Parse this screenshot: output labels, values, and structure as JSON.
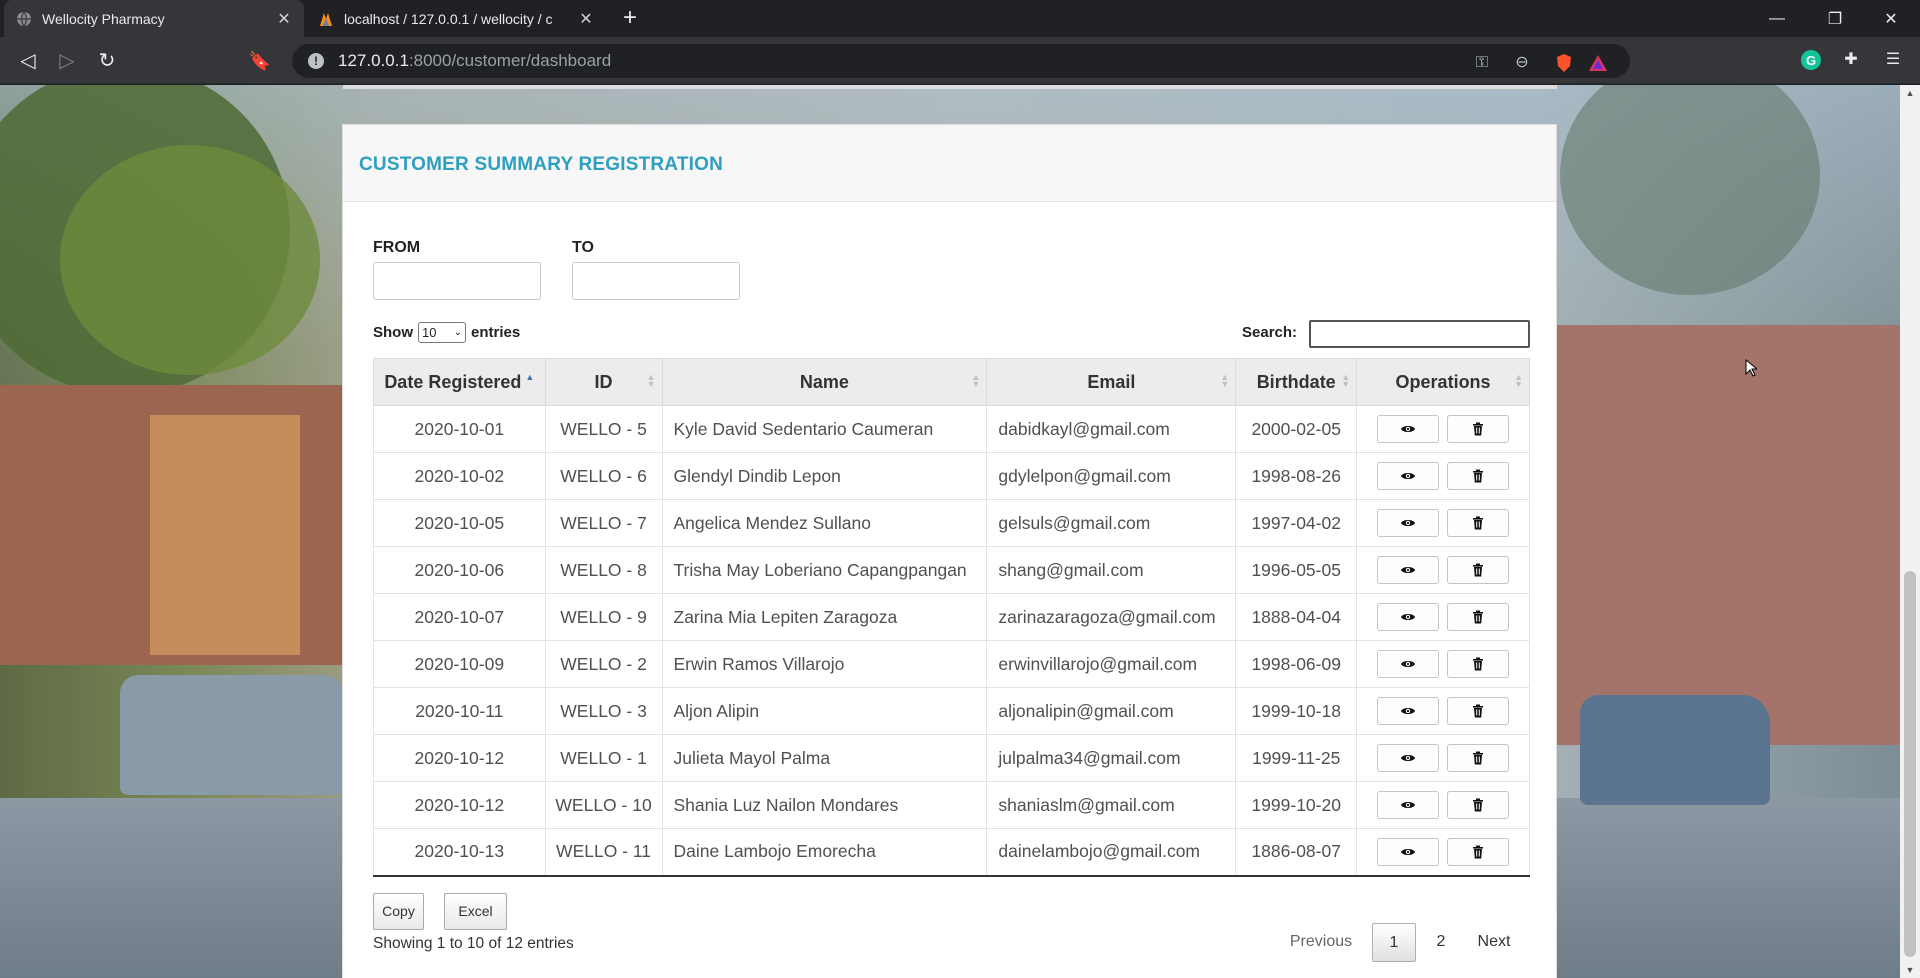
{
  "browser": {
    "tabs": [
      {
        "title": "Wellocity Pharmacy",
        "active": true
      },
      {
        "title": "localhost / 127.0.0.1 / wellocity / c",
        "active": false
      }
    ],
    "url_host": "127.0.0.1",
    "url_rest": ":8000/customer/dashboard"
  },
  "card": {
    "title": "CUSTOMER SUMMARY REGISTRATION",
    "from_label": "FROM",
    "to_label": "TO"
  },
  "controls": {
    "show_label": "Show",
    "entries_value": "10",
    "entries_label": "entries",
    "search_label": "Search:"
  },
  "table": {
    "columns": [
      "Date Registered",
      "ID",
      "Name",
      "Email",
      "Birthdate",
      "Operations"
    ],
    "rows": [
      {
        "date": "2020-10-01",
        "id": "WELLO - 5",
        "name": "Kyle David Sedentario Caumeran",
        "email": "dabidkayl@gmail.com",
        "birthdate": "2000-02-05"
      },
      {
        "date": "2020-10-02",
        "id": "WELLO - 6",
        "name": "Glendyl Dindib Lepon",
        "email": "gdylelpon@gmail.com",
        "birthdate": "1998-08-26"
      },
      {
        "date": "2020-10-05",
        "id": "WELLO - 7",
        "name": "Angelica Mendez Sullano",
        "email": "gelsuls@gmail.com",
        "birthdate": "1997-04-02"
      },
      {
        "date": "2020-10-06",
        "id": "WELLO - 8",
        "name": "Trisha May Loberiano Capangpangan",
        "email": "shang@gmail.com",
        "birthdate": "1996-05-05"
      },
      {
        "date": "2020-10-07",
        "id": "WELLO - 9",
        "name": "Zarina Mia Lepiten Zaragoza",
        "email": "zarinazaragoza@gmail.com",
        "birthdate": "1888-04-04"
      },
      {
        "date": "2020-10-09",
        "id": "WELLO - 2",
        "name": "Erwin Ramos Villarojo",
        "email": "erwinvillarojo@gmail.com",
        "birthdate": "1998-06-09"
      },
      {
        "date": "2020-10-11",
        "id": "WELLO - 3",
        "name": "Aljon Alipin",
        "email": "aljonalipin@gmail.com",
        "birthdate": "1999-10-18"
      },
      {
        "date": "2020-10-12",
        "id": "WELLO - 1",
        "name": "Julieta Mayol Palma",
        "email": "julpalma34@gmail.com",
        "birthdate": "1999-11-25"
      },
      {
        "date": "2020-10-12",
        "id": "WELLO - 10",
        "name": "Shania Luz Nailon Mondares",
        "email": "shaniaslm@gmail.com",
        "birthdate": "1999-10-20"
      },
      {
        "date": "2020-10-13",
        "id": "WELLO - 11",
        "name": "Daine Lambojo Emorecha",
        "email": "dainelambojo@gmail.com",
        "birthdate": "1886-08-07"
      }
    ],
    "row_icons": {
      "view": "eye-icon",
      "delete": "trash-icon"
    }
  },
  "buttons": {
    "copy": "Copy",
    "excel": "Excel"
  },
  "footer": {
    "info": "Showing 1 to 10 of 12 entries",
    "previous": "Previous",
    "pages": [
      "1",
      "2"
    ],
    "next": "Next"
  },
  "colors": {
    "title": "#2e9fc0",
    "header_bg": "#ececec"
  }
}
